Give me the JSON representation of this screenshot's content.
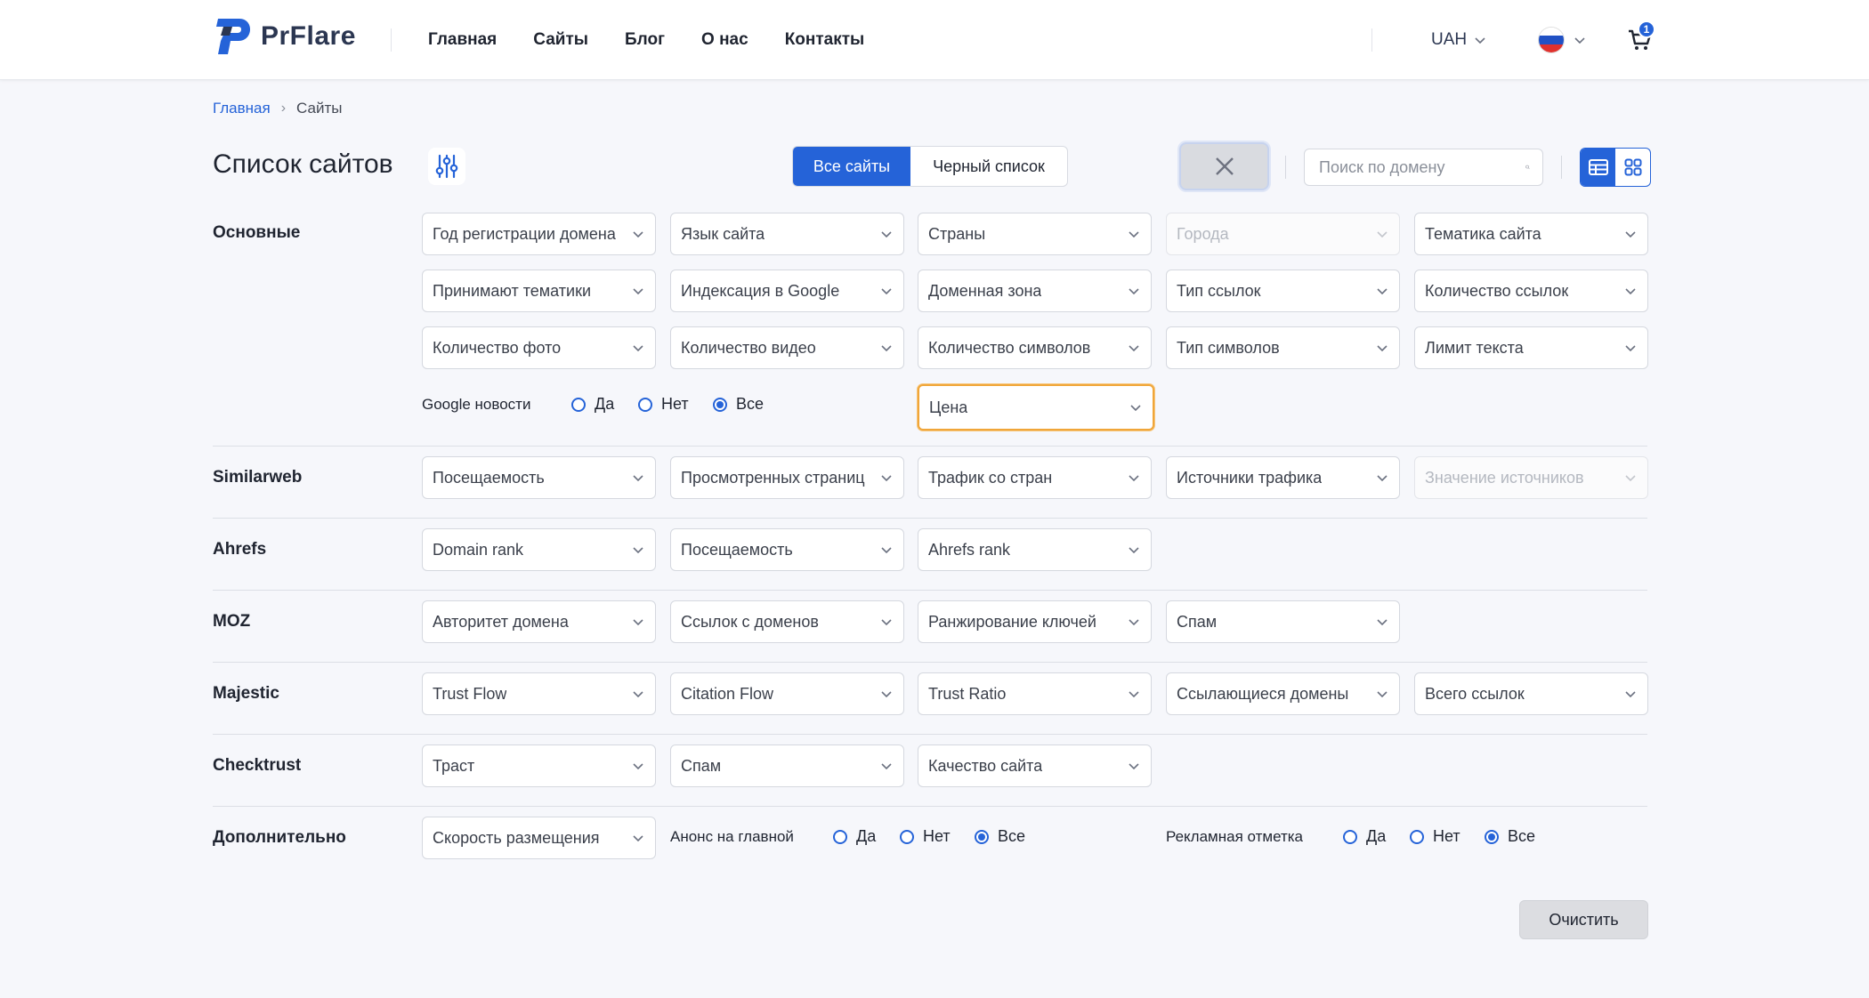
{
  "header": {
    "logo_text": "PrFlare",
    "nav": [
      "Главная",
      "Сайты",
      "Блог",
      "О нас",
      "Контакты"
    ],
    "currency": "UAH",
    "cart_count": "1",
    "flag_colors": [
      "#ffffff",
      "#2151c4",
      "#e0312d"
    ]
  },
  "breadcrumb": {
    "home": "Главная",
    "separator": "›",
    "current": "Сайты"
  },
  "title": "Список сайтов",
  "tabs": {
    "all": "Все сайты",
    "blacklist": "Черный список"
  },
  "search": {
    "placeholder": "Поиск по домену"
  },
  "sections": {
    "basic": {
      "title": "Основные",
      "row1": [
        "Год регистрации домена",
        "Язык сайта",
        "Страны",
        "Города",
        "Тематика сайта"
      ],
      "row2": [
        "Принимают тематики",
        "Индексация в Google",
        "Доменная зона",
        "Тип ссылок",
        "Количество ссылок"
      ],
      "row3": [
        "Количество фото",
        "Количество видео",
        "Количество символов",
        "Тип символов",
        "Лимит текста"
      ],
      "google_news": {
        "label": "Google новости",
        "yes": "Да",
        "no": "Нет",
        "all": "Все",
        "selected": "Все"
      },
      "price": "Цена"
    },
    "similarweb": {
      "title": "Similarweb",
      "items": [
        "Посещаемость",
        "Просмотренных страниц",
        "Трафик со стран",
        "Источники трафика",
        "Значение источников"
      ]
    },
    "ahrefs": {
      "title": "Ahrefs",
      "items": [
        "Domain rank",
        "Посещаемость",
        "Ahrefs rank"
      ]
    },
    "moz": {
      "title": "MOZ",
      "items": [
        "Авторитет домена",
        "Ссылок с доменов",
        "Ранжирование ключей",
        "Спам"
      ]
    },
    "majestic": {
      "title": "Majestic",
      "items": [
        "Trust Flow",
        "Citation Flow",
        "Trust Ratio",
        "Ссылающиеся домены",
        "Всего ссылок"
      ]
    },
    "checktrust": {
      "title": "Checktrust",
      "items": [
        "Траст",
        "Спам",
        "Качество сайта"
      ]
    },
    "extra": {
      "title": "Дополнительно",
      "speed": "Скорость размещения",
      "announce": {
        "label": "Анонс на главной",
        "yes": "Да",
        "no": "Нет",
        "all": "Все",
        "selected": "Все"
      },
      "ad_mark": {
        "label": "Рекламная отметка",
        "yes": "Да",
        "no": "Нет",
        "all": "Все",
        "selected": "Все"
      }
    }
  },
  "clear_label": "Очистить",
  "accent_color": "#2563d8"
}
